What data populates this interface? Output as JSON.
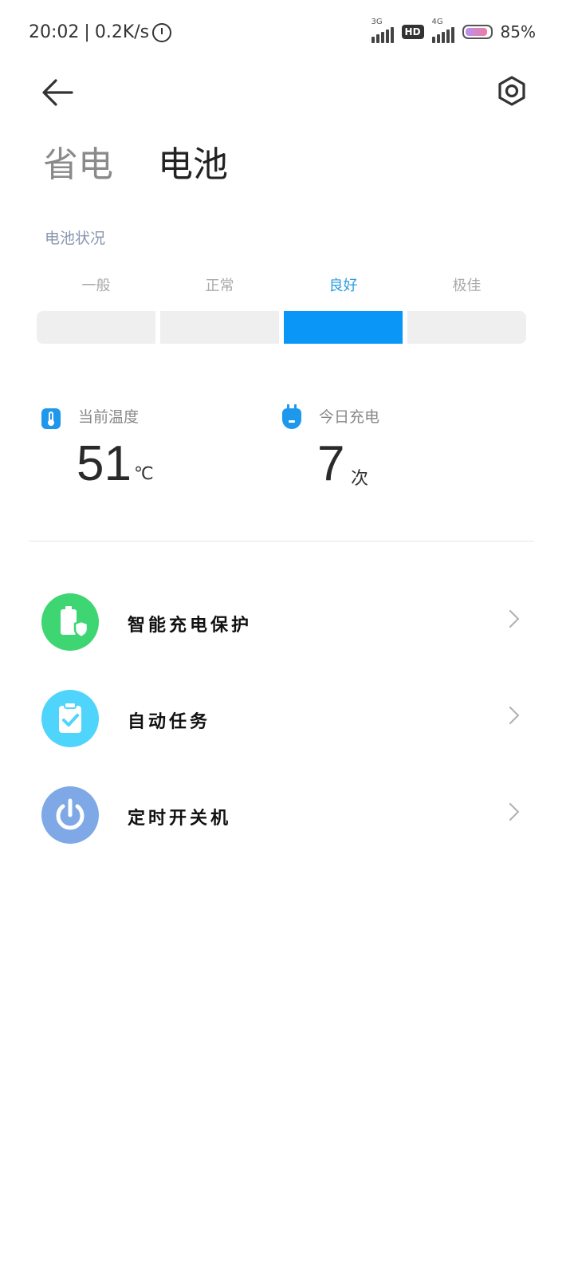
{
  "status_bar": {
    "time": "20:02",
    "speed": "0.2K/s",
    "sim1_type": "3G",
    "hd": "HD",
    "sim2_type": "4G",
    "battery": "85%"
  },
  "header": {
    "title_secondary": "省电",
    "title_primary": "电池"
  },
  "battery_status": {
    "label": "电池状况",
    "levels": [
      "一般",
      "正常",
      "良好",
      "极佳"
    ],
    "active_index": 2,
    "active_color": "#0a96f7"
  },
  "stats": {
    "temperature": {
      "label": "当前温度",
      "value": "51",
      "unit": "℃"
    },
    "charges": {
      "label": "今日充电",
      "value": "7",
      "unit": "次"
    }
  },
  "menu": [
    {
      "label": "智能充电保护",
      "icon": "battery-shield-icon",
      "color": "#3dd672"
    },
    {
      "label": "自动任务",
      "icon": "clipboard-check-icon",
      "color": "#4fd4fb"
    },
    {
      "label": "定时开关机",
      "icon": "power-icon",
      "color": "#7fa8e6"
    }
  ]
}
